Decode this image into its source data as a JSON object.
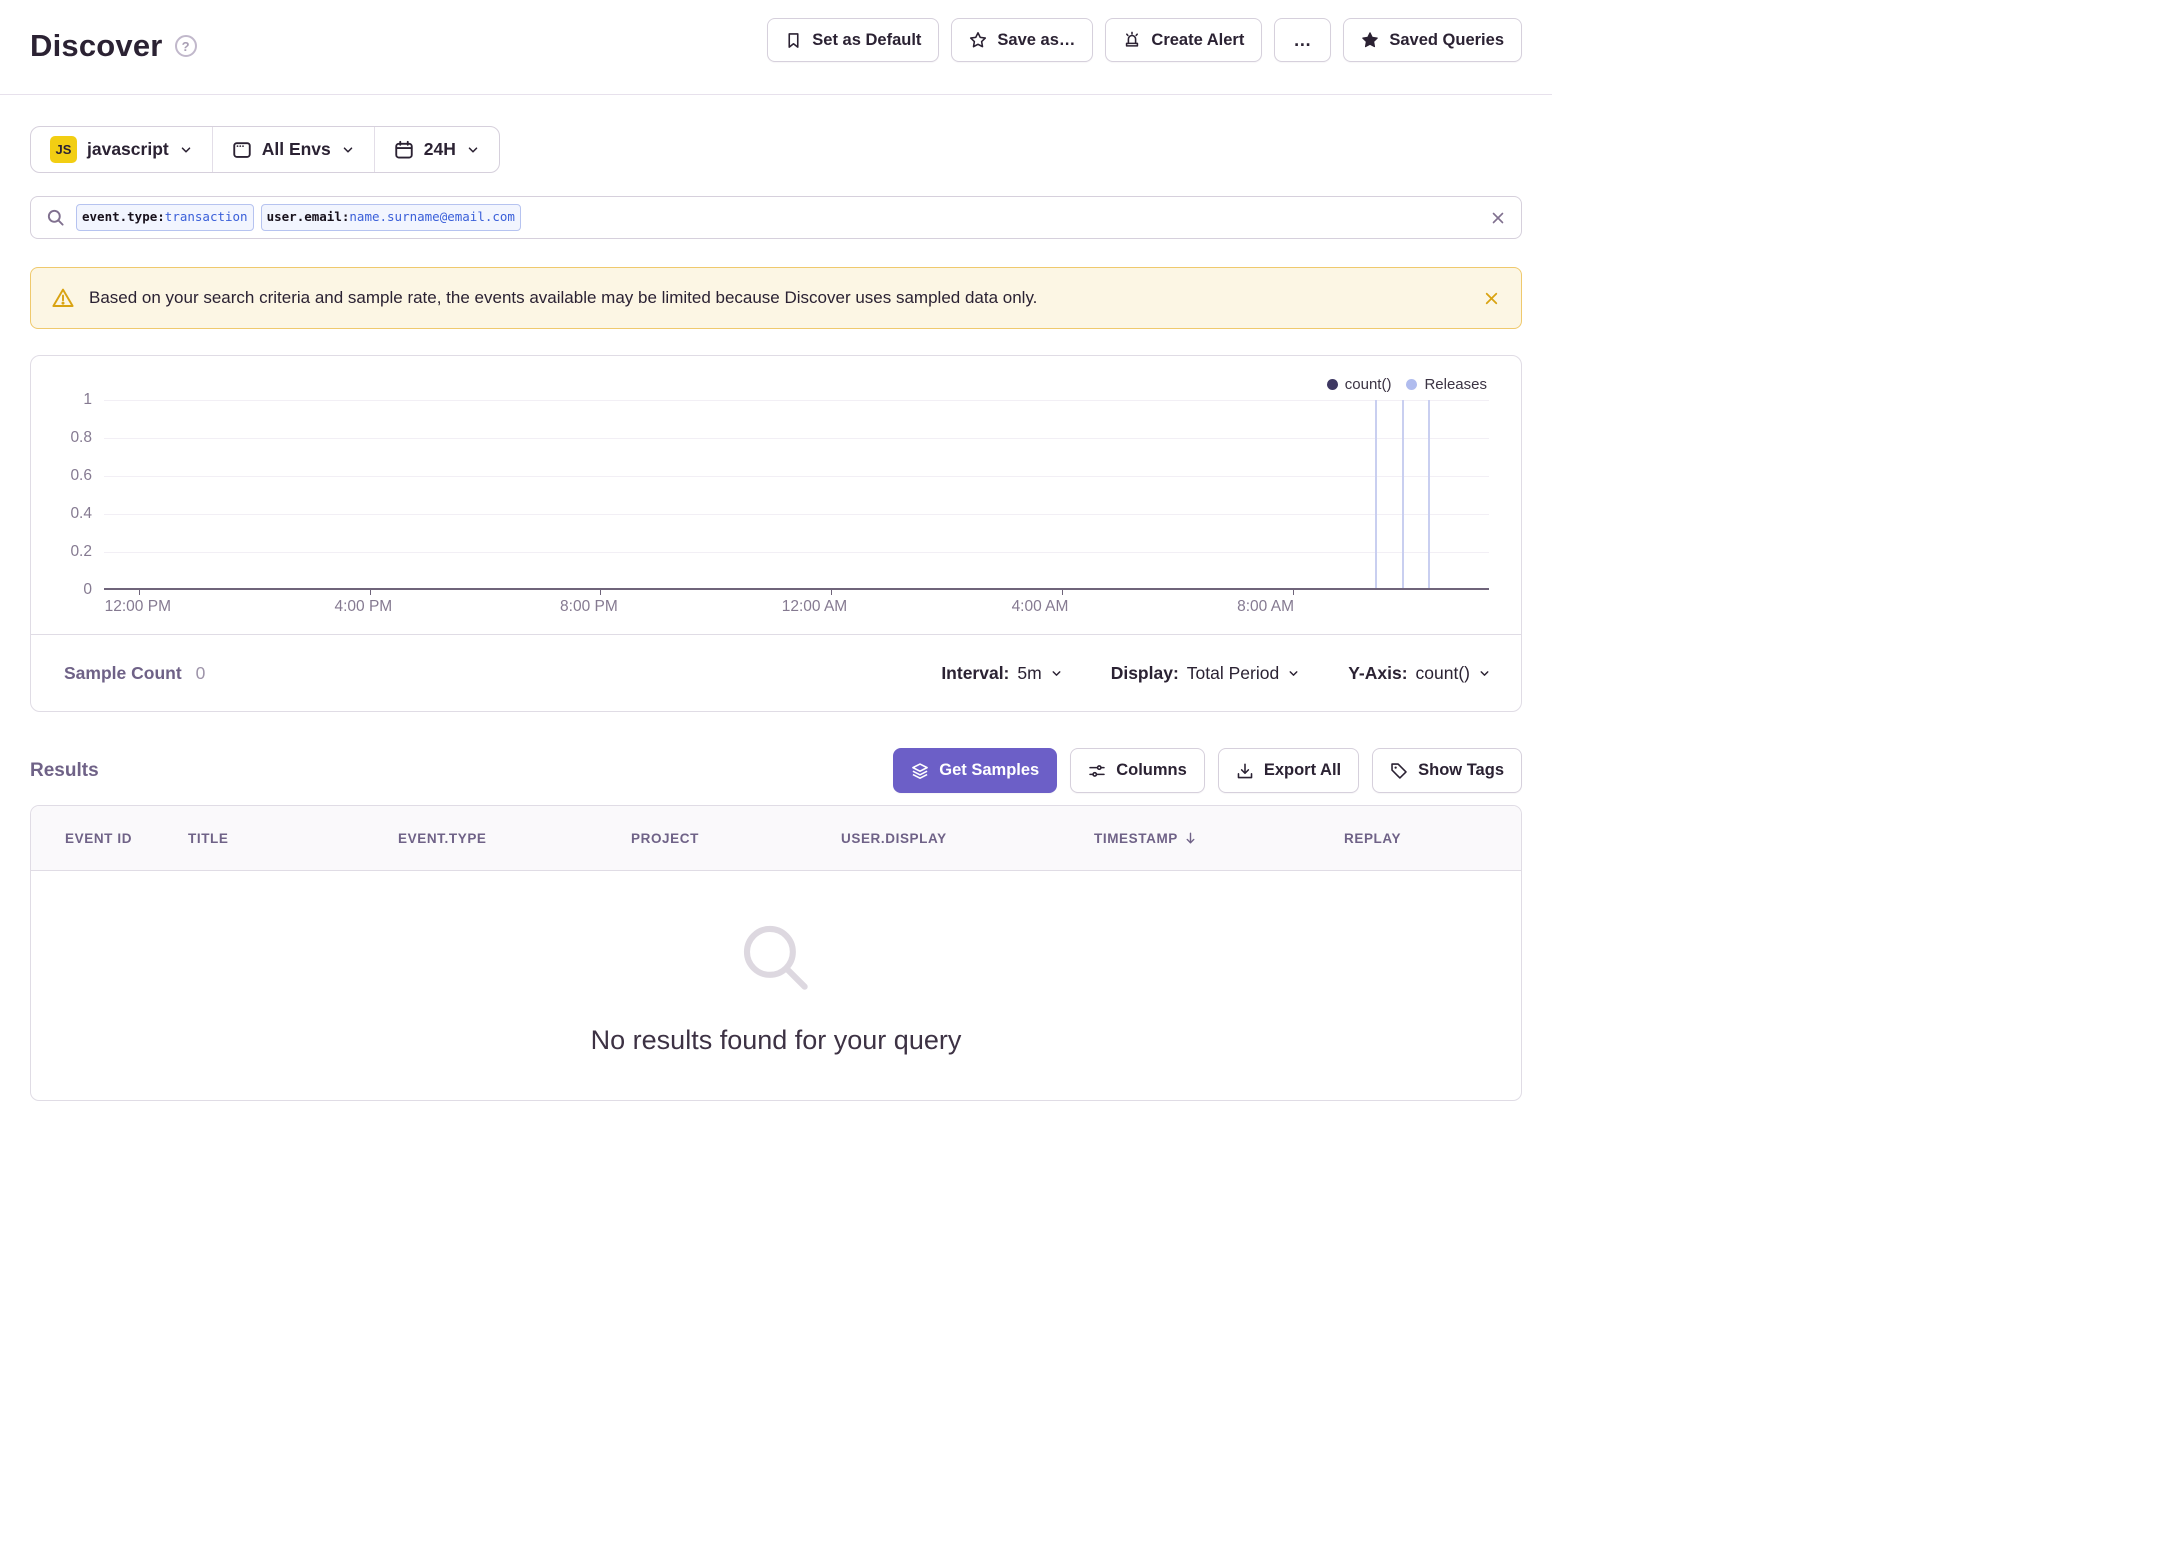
{
  "header": {
    "title": "Discover",
    "help": "?",
    "actions": [
      {
        "icon": "bookmark-icon",
        "label": "Set as Default"
      },
      {
        "icon": "star-outline-icon",
        "label": "Save as…"
      },
      {
        "icon": "siren-icon",
        "label": "Create Alert"
      },
      {
        "icon": "ellipsis-icon",
        "label": "…"
      },
      {
        "icon": "star-filled-icon",
        "label": "Saved Queries"
      }
    ]
  },
  "filters": {
    "project_badge": "JS",
    "project": "javascript",
    "environment": "All Envs",
    "timeframe": "24H"
  },
  "search": {
    "tokens": [
      {
        "key": "event.type:",
        "value": "transaction"
      },
      {
        "key": "user.email:",
        "value": "name.surname@email.com"
      }
    ]
  },
  "banner": {
    "message": "Based on your search criteria and sample rate, the events available may be limited because Discover uses sampled data only."
  },
  "chart": {
    "legend": [
      {
        "label": "count()",
        "color": "#3E3862"
      },
      {
        "label": "Releases",
        "color": "#B0BCEE"
      }
    ],
    "y_ticks": [
      "1",
      "0.8",
      "0.6",
      "0.4",
      "0.2",
      "0"
    ],
    "x_ticks": [
      "12:00 PM",
      "4:00 PM",
      "8:00 PM",
      "12:00 AM",
      "4:00 AM",
      "8:00 AM"
    ],
    "releases_x_pct": [
      91.8,
      93.7,
      95.6
    ],
    "footer": {
      "sample_count_label": "Sample Count",
      "sample_count_value": "0",
      "interval_label": "Interval:",
      "interval_value": "5m",
      "display_label": "Display:",
      "display_value": "Total Period",
      "yaxis_label": "Y-Axis:",
      "yaxis_value": "count()"
    }
  },
  "chart_data": {
    "type": "line",
    "title": "",
    "xlabel": "",
    "ylabel": "",
    "ylim": [
      0,
      1
    ],
    "y_tick_values": [
      0,
      0.2,
      0.4,
      0.6,
      0.8,
      1
    ],
    "x_tick_labels": [
      "12:00 PM",
      "4:00 PM",
      "8:00 PM",
      "12:00 AM",
      "4:00 AM",
      "8:00 AM"
    ],
    "grid": true,
    "legend_position": "top-right",
    "series": [
      {
        "name": "count()",
        "values": [],
        "note": "no data points rendered; sample count is 0 across the 24H window"
      }
    ],
    "release_markers": {
      "name": "Releases",
      "x_pct_of_plot": [
        91.8,
        93.7,
        95.6
      ]
    }
  },
  "results": {
    "title": "Results",
    "buttons": [
      {
        "icon": "layers-icon",
        "label": "Get Samples",
        "variant": "primary"
      },
      {
        "icon": "sliders-icon",
        "label": "Columns"
      },
      {
        "icon": "download-icon",
        "label": "Export All"
      },
      {
        "icon": "tag-icon",
        "label": "Show Tags"
      }
    ],
    "table": {
      "columns": [
        {
          "label": "EVENT ID"
        },
        {
          "label": "TITLE"
        },
        {
          "label": "EVENT.TYPE"
        },
        {
          "label": "PROJECT"
        },
        {
          "label": "USER.DISPLAY"
        },
        {
          "label": "TIMESTAMP",
          "sorted": "desc"
        },
        {
          "label": "REPLAY"
        }
      ],
      "empty_message": "No results found for your query"
    }
  }
}
